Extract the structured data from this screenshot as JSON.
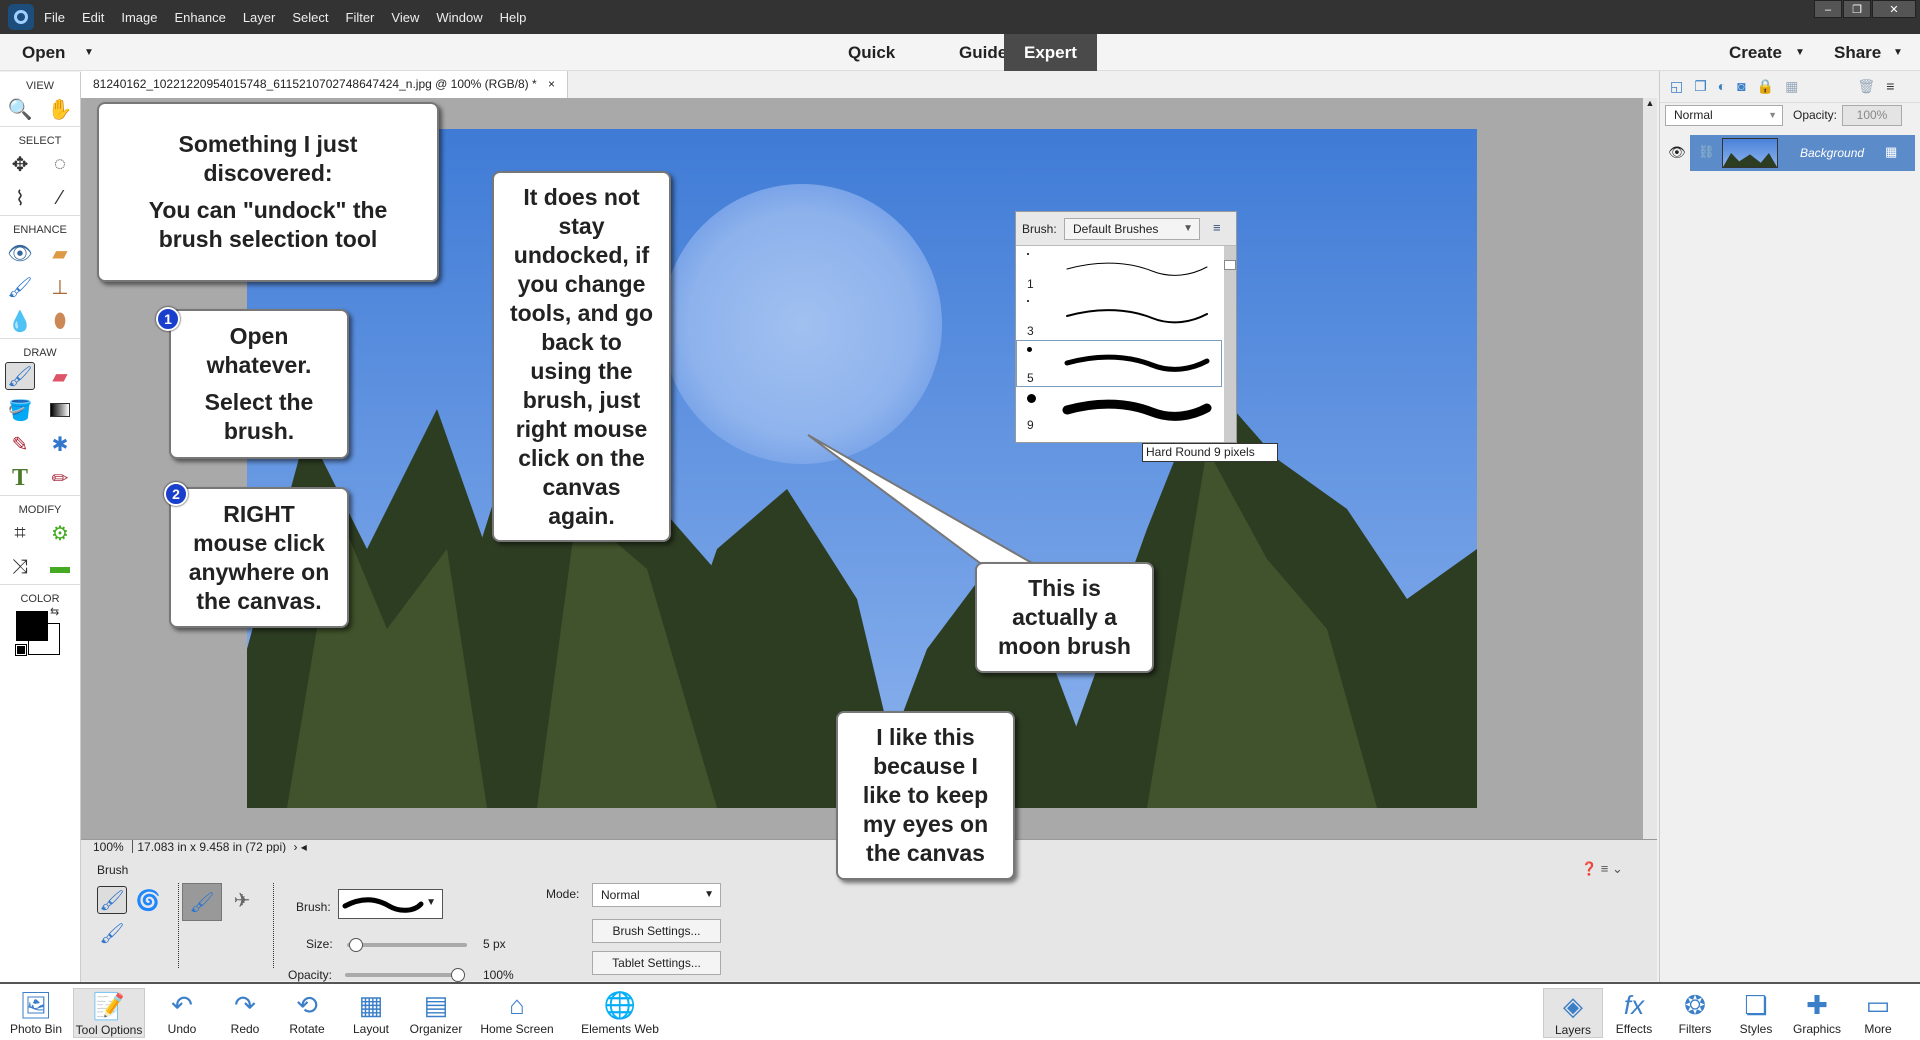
{
  "menubar": {
    "items": [
      "File",
      "Edit",
      "Image",
      "Enhance",
      "Layer",
      "Select",
      "Filter",
      "View",
      "Window",
      "Help"
    ],
    "window_controls": [
      "–",
      "❐",
      "✕"
    ]
  },
  "modebar": {
    "open": "Open",
    "modes": [
      "Quick",
      "Guided",
      "Expert"
    ],
    "active_mode": "Expert",
    "create": "Create",
    "share": "Share"
  },
  "document": {
    "tab_title": "81240162_10221220954015748_6115210702748647424_n.jpg @ 100% (RGB/8) *",
    "close": "×"
  },
  "toolbox": {
    "sections": [
      "VIEW",
      "SELECT",
      "ENHANCE",
      "DRAW",
      "MODIFY",
      "COLOR"
    ]
  },
  "status": {
    "zoom": "100%",
    "dimensions": "17.083 in x 9.458 in (72 ppi)"
  },
  "tool_options": {
    "title": "Brush",
    "brush_label": "Brush:",
    "size_label": "Size:",
    "size_value": "5 px",
    "size_fraction": 0.02,
    "opacity_label": "Opacity:",
    "opacity_value": "100%",
    "opacity_fraction": 1.0,
    "mode_label": "Mode:",
    "mode_value": "Normal",
    "brush_settings": "Brush Settings...",
    "tablet_settings": "Tablet Settings..."
  },
  "brush_panel": {
    "label": "Brush:",
    "set": "Default Brushes",
    "items": [
      {
        "size": "1"
      },
      {
        "size": "3"
      },
      {
        "size": "5"
      },
      {
        "size": "9"
      }
    ],
    "selected_index": 2,
    "tooltip": "Hard Round 9 pixels"
  },
  "layers": {
    "blend_mode": "Normal",
    "opacity_label": "Opacity:",
    "opacity_value": "100%",
    "layer_name": "Background"
  },
  "callouts": {
    "c1": [
      "Something I just",
      "discovered:",
      "You can \"undock\" the",
      "brush selection tool"
    ],
    "c2": [
      "Open",
      "whatever.",
      "Select the",
      "brush."
    ],
    "c3": [
      "RIGHT",
      "mouse click",
      "anywhere on",
      "the canvas."
    ],
    "c4": [
      "It does not",
      "stay",
      "undocked, if",
      "you change",
      "tools, and go",
      "back to",
      "using the",
      "brush, just",
      "right mouse",
      "click on the",
      "canvas",
      "again."
    ],
    "c5": [
      "This is",
      "actually a",
      "moon brush"
    ],
    "c6": [
      "I like this",
      "because I",
      "like to keep",
      "my eyes on",
      "the canvas"
    ],
    "step1": "1",
    "step2": "2"
  },
  "bottombar": {
    "left": [
      {
        "label": "Photo Bin",
        "icon": "photo-bin-icon"
      },
      {
        "label": "Tool Options",
        "icon": "tool-options-icon"
      },
      {
        "label": "Undo",
        "icon": "undo-icon"
      },
      {
        "label": "Redo",
        "icon": "redo-icon"
      },
      {
        "label": "Rotate",
        "icon": "rotate-icon"
      },
      {
        "label": "Layout",
        "icon": "layout-icon"
      },
      {
        "label": "Organizer",
        "icon": "organizer-icon"
      },
      {
        "label": "Home Screen",
        "icon": "home-icon"
      },
      {
        "label": "Elements Web",
        "icon": "globe-icon"
      }
    ],
    "right": [
      {
        "label": "Layers",
        "icon": "layers-icon"
      },
      {
        "label": "Effects",
        "icon": "fx-icon"
      },
      {
        "label": "Filters",
        "icon": "filters-icon"
      },
      {
        "label": "Styles",
        "icon": "styles-icon"
      },
      {
        "label": "Graphics",
        "icon": "plus-icon"
      },
      {
        "label": "More",
        "icon": "more-icon"
      }
    ]
  },
  "colors": {
    "accent": "#4a4a4a",
    "sky_top": "#3f7bd6",
    "sky_bottom": "#8db3ee",
    "selection": "#5b8bc9"
  }
}
